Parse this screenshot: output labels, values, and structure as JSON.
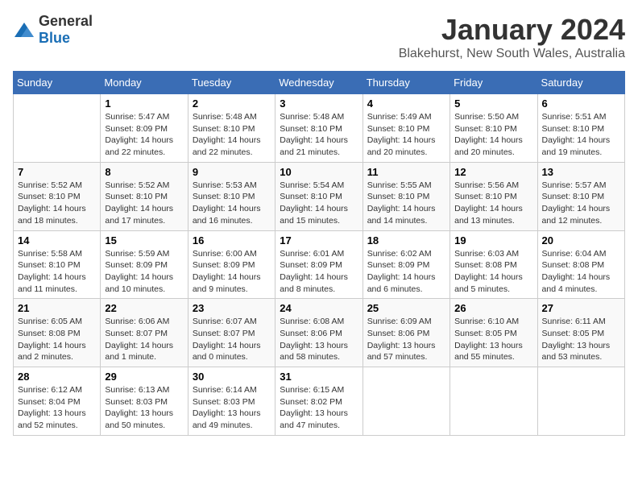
{
  "logo": {
    "general": "General",
    "blue": "Blue"
  },
  "title": "January 2024",
  "subtitle": "Blakehurst, New South Wales, Australia",
  "days_of_week": [
    "Sunday",
    "Monday",
    "Tuesday",
    "Wednesday",
    "Thursday",
    "Friday",
    "Saturday"
  ],
  "weeks": [
    [
      {
        "day": "",
        "info": ""
      },
      {
        "day": "1",
        "info": "Sunrise: 5:47 AM\nSunset: 8:09 PM\nDaylight: 14 hours\nand 22 minutes."
      },
      {
        "day": "2",
        "info": "Sunrise: 5:48 AM\nSunset: 8:10 PM\nDaylight: 14 hours\nand 22 minutes."
      },
      {
        "day": "3",
        "info": "Sunrise: 5:48 AM\nSunset: 8:10 PM\nDaylight: 14 hours\nand 21 minutes."
      },
      {
        "day": "4",
        "info": "Sunrise: 5:49 AM\nSunset: 8:10 PM\nDaylight: 14 hours\nand 20 minutes."
      },
      {
        "day": "5",
        "info": "Sunrise: 5:50 AM\nSunset: 8:10 PM\nDaylight: 14 hours\nand 20 minutes."
      },
      {
        "day": "6",
        "info": "Sunrise: 5:51 AM\nSunset: 8:10 PM\nDaylight: 14 hours\nand 19 minutes."
      }
    ],
    [
      {
        "day": "7",
        "info": "Sunrise: 5:52 AM\nSunset: 8:10 PM\nDaylight: 14 hours\nand 18 minutes."
      },
      {
        "day": "8",
        "info": "Sunrise: 5:52 AM\nSunset: 8:10 PM\nDaylight: 14 hours\nand 17 minutes."
      },
      {
        "day": "9",
        "info": "Sunrise: 5:53 AM\nSunset: 8:10 PM\nDaylight: 14 hours\nand 16 minutes."
      },
      {
        "day": "10",
        "info": "Sunrise: 5:54 AM\nSunset: 8:10 PM\nDaylight: 14 hours\nand 15 minutes."
      },
      {
        "day": "11",
        "info": "Sunrise: 5:55 AM\nSunset: 8:10 PM\nDaylight: 14 hours\nand 14 minutes."
      },
      {
        "day": "12",
        "info": "Sunrise: 5:56 AM\nSunset: 8:10 PM\nDaylight: 14 hours\nand 13 minutes."
      },
      {
        "day": "13",
        "info": "Sunrise: 5:57 AM\nSunset: 8:10 PM\nDaylight: 14 hours\nand 12 minutes."
      }
    ],
    [
      {
        "day": "14",
        "info": "Sunrise: 5:58 AM\nSunset: 8:10 PM\nDaylight: 14 hours\nand 11 minutes."
      },
      {
        "day": "15",
        "info": "Sunrise: 5:59 AM\nSunset: 8:09 PM\nDaylight: 14 hours\nand 10 minutes."
      },
      {
        "day": "16",
        "info": "Sunrise: 6:00 AM\nSunset: 8:09 PM\nDaylight: 14 hours\nand 9 minutes."
      },
      {
        "day": "17",
        "info": "Sunrise: 6:01 AM\nSunset: 8:09 PM\nDaylight: 14 hours\nand 8 minutes."
      },
      {
        "day": "18",
        "info": "Sunrise: 6:02 AM\nSunset: 8:09 PM\nDaylight: 14 hours\nand 6 minutes."
      },
      {
        "day": "19",
        "info": "Sunrise: 6:03 AM\nSunset: 8:08 PM\nDaylight: 14 hours\nand 5 minutes."
      },
      {
        "day": "20",
        "info": "Sunrise: 6:04 AM\nSunset: 8:08 PM\nDaylight: 14 hours\nand 4 minutes."
      }
    ],
    [
      {
        "day": "21",
        "info": "Sunrise: 6:05 AM\nSunset: 8:08 PM\nDaylight: 14 hours\nand 2 minutes."
      },
      {
        "day": "22",
        "info": "Sunrise: 6:06 AM\nSunset: 8:07 PM\nDaylight: 14 hours\nand 1 minute."
      },
      {
        "day": "23",
        "info": "Sunrise: 6:07 AM\nSunset: 8:07 PM\nDaylight: 14 hours\nand 0 minutes."
      },
      {
        "day": "24",
        "info": "Sunrise: 6:08 AM\nSunset: 8:06 PM\nDaylight: 13 hours\nand 58 minutes."
      },
      {
        "day": "25",
        "info": "Sunrise: 6:09 AM\nSunset: 8:06 PM\nDaylight: 13 hours\nand 57 minutes."
      },
      {
        "day": "26",
        "info": "Sunrise: 6:10 AM\nSunset: 8:05 PM\nDaylight: 13 hours\nand 55 minutes."
      },
      {
        "day": "27",
        "info": "Sunrise: 6:11 AM\nSunset: 8:05 PM\nDaylight: 13 hours\nand 53 minutes."
      }
    ],
    [
      {
        "day": "28",
        "info": "Sunrise: 6:12 AM\nSunset: 8:04 PM\nDaylight: 13 hours\nand 52 minutes."
      },
      {
        "day": "29",
        "info": "Sunrise: 6:13 AM\nSunset: 8:03 PM\nDaylight: 13 hours\nand 50 minutes."
      },
      {
        "day": "30",
        "info": "Sunrise: 6:14 AM\nSunset: 8:03 PM\nDaylight: 13 hours\nand 49 minutes."
      },
      {
        "day": "31",
        "info": "Sunrise: 6:15 AM\nSunset: 8:02 PM\nDaylight: 13 hours\nand 47 minutes."
      },
      {
        "day": "",
        "info": ""
      },
      {
        "day": "",
        "info": ""
      },
      {
        "day": "",
        "info": ""
      }
    ]
  ]
}
